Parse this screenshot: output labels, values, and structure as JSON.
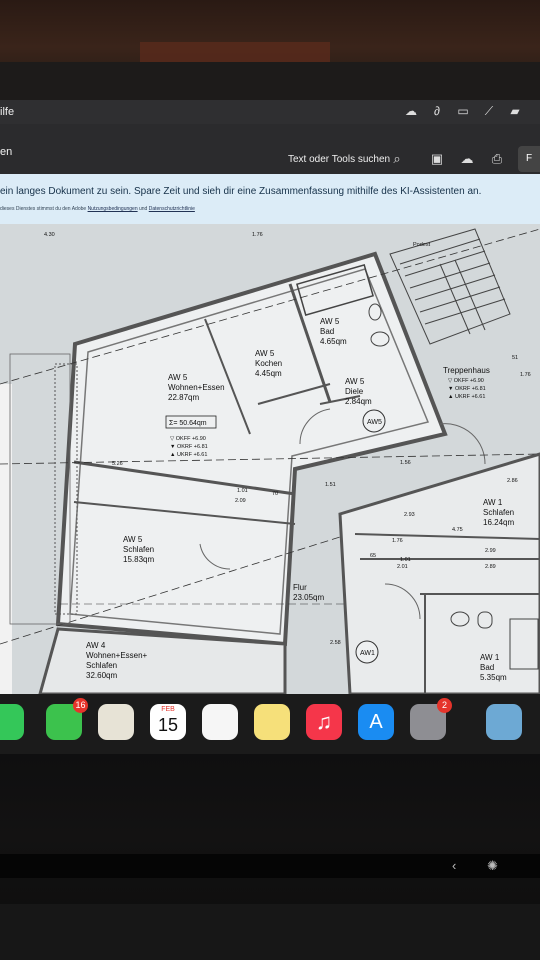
{
  "menubar": {
    "app_fragment": "ilfe"
  },
  "toolbar": {
    "doc_fragment": "en",
    "search_label": "Text oder Tools suchen",
    "tab_fragment": "F"
  },
  "banner": {
    "text": "ein langes Dokument zu sein. Spare Zeit und sieh dir eine Zusammenfassung mithilfe des KI-Assistenten an.",
    "legal_prefix": "dieses Dienstes stimmst du den Adobe",
    "legal_link1": "Nutzungsbedingungen",
    "legal_and": "und",
    "legal_link2": "Datenschutzrichtlinie"
  },
  "plan": {
    "rooms": [
      {
        "lines": [
          "AW 5",
          "Wohnen+Essen",
          "22.87qm"
        ]
      },
      {
        "lines": [
          "AW 5",
          "Kochen",
          "4.45qm"
        ]
      },
      {
        "lines": [
          "AW 5",
          "Bad",
          "4.65qm"
        ]
      },
      {
        "lines": [
          "AW 5",
          "Diele",
          "2.84qm"
        ]
      },
      {
        "lines": [
          "AW 5",
          "Schlafen",
          "15.83qm"
        ]
      },
      {
        "lines": [
          "Flur",
          "23.05qm"
        ]
      },
      {
        "lines": [
          "AW 1",
          "Schlafen",
          "16.24qm"
        ]
      },
      {
        "lines": [
          "Treppenhaus"
        ]
      },
      {
        "lines": [
          "AW 4",
          "Wohnen+Essen+",
          "Schlafen",
          "32.60qm"
        ]
      },
      {
        "lines": [
          "AW 1",
          "Bad",
          "5.35qm"
        ]
      }
    ],
    "sum_box": "Σ= 50.64qm",
    "levels_aw5": [
      "▽ OKFF +6.90",
      "▼ OKRF +6.81",
      "▲ UKRF +6.61"
    ],
    "levels_trepp": [
      "▽ OKFF +6.90",
      "▼ OKRF +6.81",
      "▲ UKRF +6.61"
    ],
    "tags": [
      "AW5",
      "AW1"
    ],
    "dims": [
      "5.26",
      "1.01",
      "2.09",
      "70",
      "1.51",
      "1.76",
      "1.01",
      "2.01",
      "2.99",
      "2.89",
      "4.75",
      "65",
      "2.93",
      "2.86",
      "1.76",
      "51",
      "1.56",
      "1.76",
      "2.58",
      "4.30"
    ],
    "podest": "Podest"
  },
  "dock": {
    "messages_badge": "16",
    "calendar_month": "FEB",
    "calendar_day": "15",
    "settings_badge": "2"
  }
}
